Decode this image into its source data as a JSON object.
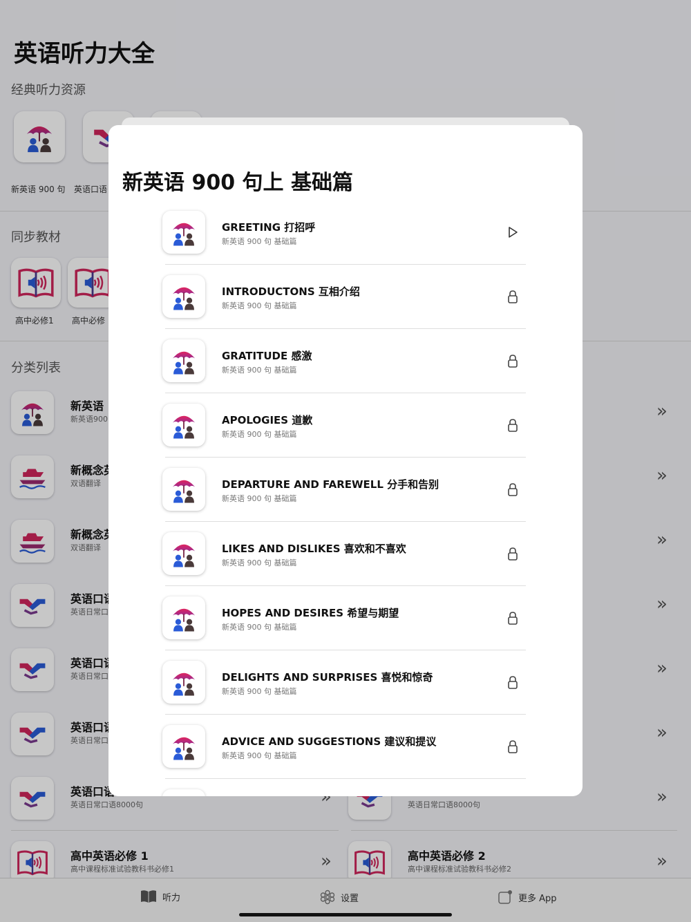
{
  "app_title": "英语听力大全",
  "sections": {
    "classic": "经典听力资源",
    "sync": "同步教材",
    "category": "分类列表"
  },
  "classic_tiles": [
    {
      "label": "新英语 900 句",
      "icon": "umbrella-people-icon"
    },
    {
      "label": "英语口语",
      "icon": "handshake-icon"
    }
  ],
  "sync_tiles": [
    {
      "label": "高中必修1",
      "icon": "book-speaker-icon"
    },
    {
      "label": "高中必修",
      "icon": "book-speaker-icon"
    }
  ],
  "category_rows": [
    {
      "title": "新英语",
      "subtitle": "新英语900",
      "icon": "umbrella-people-icon"
    },
    {
      "title": "新概念英",
      "subtitle": "双语翻译",
      "icon": "ship-icon"
    },
    {
      "title": "新概念英",
      "subtitle": "双语翻译",
      "icon": "ship-icon"
    },
    {
      "title": "英语口语",
      "subtitle": "英语日常口",
      "icon": "handshake-icon"
    },
    {
      "title": "英语口语",
      "subtitle": "英语日常口",
      "icon": "handshake-icon"
    },
    {
      "title": "英语口语",
      "subtitle": "英语日常口",
      "icon": "handshake-icon"
    },
    {
      "title": "英语口语",
      "subtitle": "英语日常口语8000句",
      "icon": "handshake-icon"
    },
    {
      "title": "高中英语必修 1",
      "subtitle": "高中课程标准试验教科书必修1",
      "icon": "book-speaker-icon"
    }
  ],
  "category_rows_right": [
    {
      "title": "",
      "subtitle": "英语日常口语8000句",
      "icon": "handshake-icon"
    },
    {
      "title": "高中英语必修 2",
      "subtitle": "高中课程标准试验教科书必修2",
      "icon": "book-speaker-icon"
    }
  ],
  "tabs": [
    {
      "label": "听力",
      "icon": "book-icon"
    },
    {
      "label": "设置",
      "icon": "flower-gear-icon"
    },
    {
      "label": "更多 App",
      "icon": "app-badge-icon"
    }
  ],
  "sheet": {
    "title": "新英语 900 句上 基础篇",
    "lessons": [
      {
        "title": "GREETING 打招呼",
        "subtitle": "新英语 900 句 基础篇",
        "action": "play-icon"
      },
      {
        "title": "INTRODUCTONS 互相介绍",
        "subtitle": "新英语 900 句 基础篇",
        "action": "lock-icon"
      },
      {
        "title": "GRATITUDE 感激",
        "subtitle": "新英语 900 句 基础篇",
        "action": "lock-icon"
      },
      {
        "title": "APOLOGIES 道歉",
        "subtitle": "新英语 900 句 基础篇",
        "action": "lock-icon"
      },
      {
        "title": "DEPARTURE AND FAREWELL 分手和告别",
        "subtitle": "新英语 900 句 基础篇",
        "action": "lock-icon"
      },
      {
        "title": "LIKES AND DISLIKES 喜欢和不喜欢",
        "subtitle": "新英语 900 句 基础篇",
        "action": "lock-icon"
      },
      {
        "title": "HOPES AND DESIRES 希望与期望",
        "subtitle": "新英语 900 句 基础篇",
        "action": "lock-icon"
      },
      {
        "title": "DELIGHTS AND SURPRISES 喜悦和惊奇",
        "subtitle": "新英语 900 句 基础篇",
        "action": "lock-icon"
      },
      {
        "title": "ADVICE AND SUGGESTIONS 建议和提议",
        "subtitle": "新英语 900 句 基础篇",
        "action": "lock-icon"
      }
    ]
  },
  "colors": {
    "accent_red": "#e0245e",
    "accent_blue": "#2a5bd7",
    "dark_person": "#4a3a3a"
  }
}
